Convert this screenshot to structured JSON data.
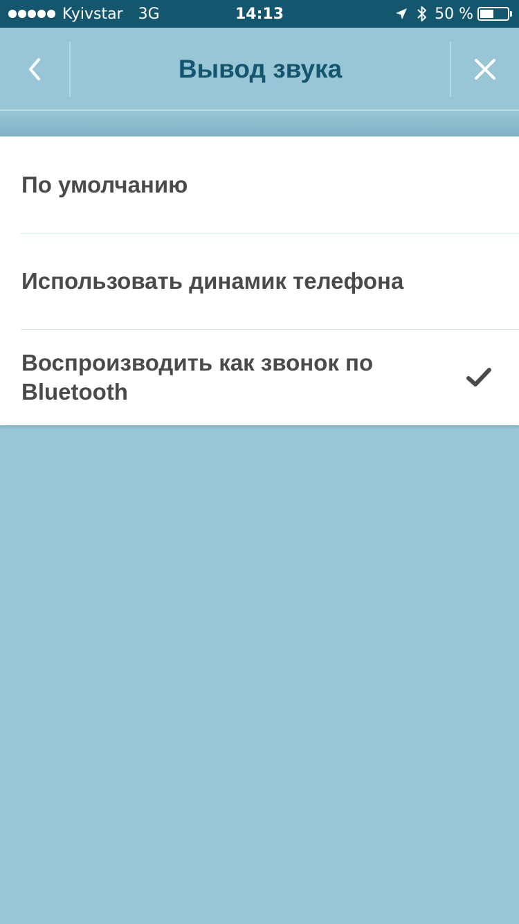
{
  "status_bar": {
    "carrier": "Kyivstar",
    "network": "3G",
    "time": "14:13",
    "battery_text": "50 %",
    "battery_level": 0.5,
    "icons": [
      "signal-dots-icon",
      "location-arrow-icon",
      "bluetooth-icon",
      "battery-icon"
    ]
  },
  "nav": {
    "title": "Вывод звука",
    "back_icon": "chevron-left-icon",
    "close_icon": "close-icon"
  },
  "options": [
    {
      "label": "По умолчанию",
      "selected": false
    },
    {
      "label": "Использовать динамик телефона",
      "selected": false
    },
    {
      "label": "Воспроизводить как звонок по Bluetooth",
      "selected": true
    }
  ],
  "colors": {
    "status_bar_bg": "#13566e",
    "nav_bg": "#98c6d6",
    "title": "#13566e",
    "list_bg": "#ffffff",
    "option_text": "#4a4a4a",
    "checkmark": "#4a4a4a",
    "page_bg": "#98c6d6"
  }
}
